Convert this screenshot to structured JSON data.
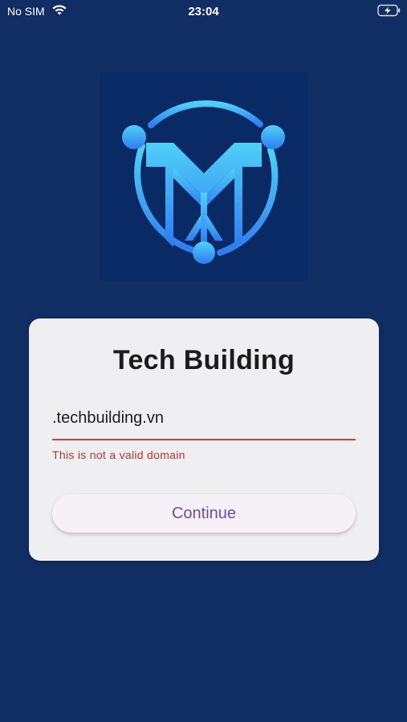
{
  "status_bar": {
    "carrier": "No SIM",
    "time": "23:04",
    "icons": [
      "wifi-icon",
      "battery-charging-icon"
    ]
  },
  "logo": {
    "icon": "tech-building-logo"
  },
  "card": {
    "title": "Tech Building",
    "domain_input": {
      "value": ".techbuilding.vn",
      "placeholder": ""
    },
    "error_text": "This is not a valid domain",
    "continue_label": "Continue"
  },
  "colors": {
    "background": "#112e64",
    "card": "#efeff2",
    "error": "#c8453b",
    "button_text": "#6a4ea1",
    "logo_accent": "#3aa0ff"
  }
}
